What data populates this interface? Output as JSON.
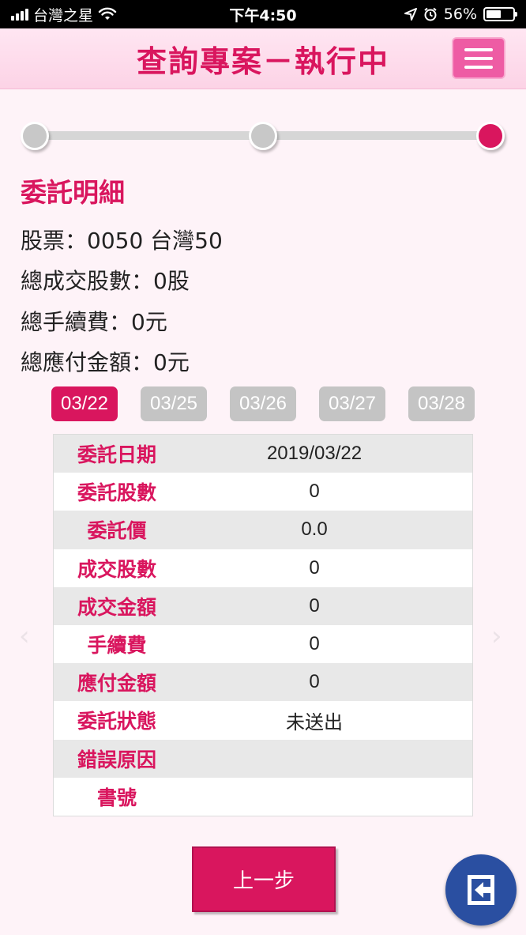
{
  "status_bar": {
    "carrier": "台灣之星",
    "time": "下午4:50",
    "battery": "56%",
    "battery_level": 0.56
  },
  "header": {
    "title": "查詢專案－執行中",
    "menu_icon": "hamburger-menu-icon"
  },
  "progress": {
    "total_steps": 3,
    "current_step": 3
  },
  "detail": {
    "section_title": "委託明細",
    "stock": "股票：0050 台灣50",
    "total_shares": "總成交股數：0股",
    "total_fee": "總手續費：0元",
    "total_payable": "總應付金額：0元"
  },
  "date_tabs": [
    {
      "label": "03/22",
      "active": true
    },
    {
      "label": "03/25",
      "active": false
    },
    {
      "label": "03/26",
      "active": false
    },
    {
      "label": "03/27",
      "active": false
    },
    {
      "label": "03/28",
      "active": false
    }
  ],
  "table": {
    "rows": [
      {
        "label": "委託日期",
        "value": "2019/03/22"
      },
      {
        "label": "委託股數",
        "value": "0"
      },
      {
        "label": "委託價",
        "value": "0.0"
      },
      {
        "label": "成交股數",
        "value": "0"
      },
      {
        "label": "成交金額",
        "value": "0"
      },
      {
        "label": "手續費",
        "value": "0"
      },
      {
        "label": "應付金額",
        "value": "0"
      },
      {
        "label": "委託狀態",
        "value": "未送出"
      },
      {
        "label": "錯誤原因",
        "value": ""
      },
      {
        "label": "書號",
        "value": ""
      }
    ]
  },
  "buttons": {
    "prev_label": "上一步",
    "exit_icon": "exit-icon"
  },
  "colors": {
    "accent": "#d9165e",
    "header_bg": "#fcd3e6",
    "page_bg": "#fef3f8",
    "inactive_tab": "#c4c4c4",
    "exit_button": "#2a4fa1"
  }
}
